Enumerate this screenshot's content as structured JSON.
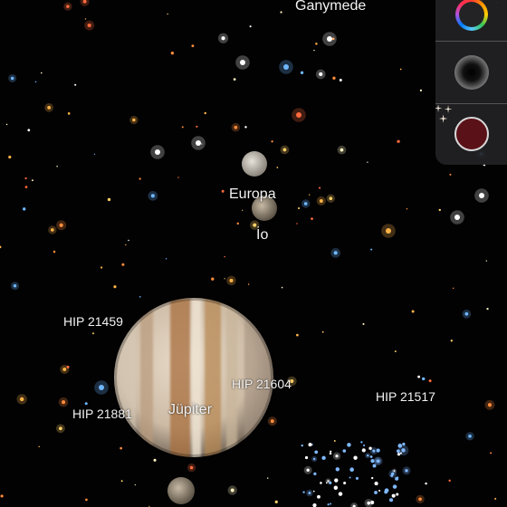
{
  "labels": {
    "ganymede": "Ganymede",
    "europa": "Europa",
    "io": "İo",
    "jupiter": "Jüpiter",
    "hip21459": "HIP 21459",
    "hip21881": "HIP 21881",
    "hip21604": "HIP 21604",
    "hip21517": "HIP 21517"
  },
  "toolbar": {
    "color_filter_icon": "color-wheel-icon",
    "brightness_icon": "glow-disc-icon",
    "constellation_icon": "sparkle-stars-icon"
  },
  "colors": {
    "sky": "#020203",
    "panel": "#232325",
    "constellation_button": "#5a1218"
  }
}
